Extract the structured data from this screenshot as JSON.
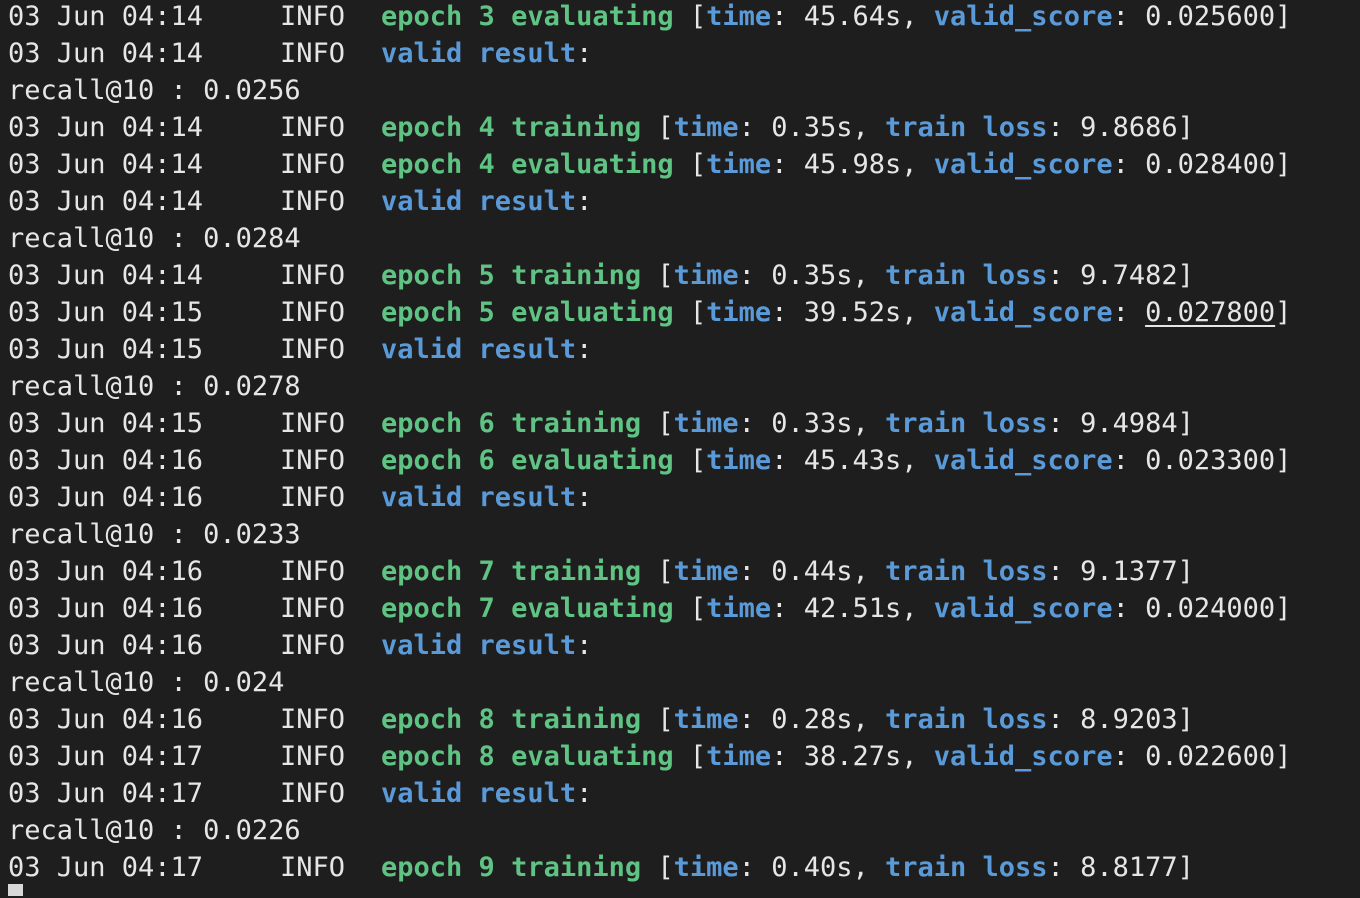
{
  "lines": [
    {
      "kind": "eval",
      "ts": "03 Jun 04:14",
      "level": "INFO",
      "epoch": "3",
      "time": "45.64s",
      "score": "0.025600"
    },
    {
      "kind": "result",
      "ts": "03 Jun 04:14",
      "level": "INFO"
    },
    {
      "kind": "recall",
      "text": "recall@10 : 0.0256"
    },
    {
      "kind": "train",
      "ts": "03 Jun 04:14",
      "level": "INFO",
      "epoch": "4",
      "time": "0.35s",
      "loss": "9.8686"
    },
    {
      "kind": "eval",
      "ts": "03 Jun 04:14",
      "level": "INFO",
      "epoch": "4",
      "time": "45.98s",
      "score": "0.028400"
    },
    {
      "kind": "result",
      "ts": "03 Jun 04:14",
      "level": "INFO"
    },
    {
      "kind": "recall",
      "text": "recall@10 : 0.0284"
    },
    {
      "kind": "train",
      "ts": "03 Jun 04:14",
      "level": "INFO",
      "epoch": "5",
      "time": "0.35s",
      "loss": "9.7482"
    },
    {
      "kind": "eval",
      "ts": "03 Jun 04:15",
      "level": "INFO",
      "epoch": "5",
      "time": "39.52s",
      "score": "0.027800",
      "underline": true
    },
    {
      "kind": "result",
      "ts": "03 Jun 04:15",
      "level": "INFO"
    },
    {
      "kind": "recall",
      "text": "recall@10 : 0.0278"
    },
    {
      "kind": "train",
      "ts": "03 Jun 04:15",
      "level": "INFO",
      "epoch": "6",
      "time": "0.33s",
      "loss": "9.4984"
    },
    {
      "kind": "eval",
      "ts": "03 Jun 04:16",
      "level": "INFO",
      "epoch": "6",
      "time": "45.43s",
      "score": "0.023300"
    },
    {
      "kind": "result",
      "ts": "03 Jun 04:16",
      "level": "INFO"
    },
    {
      "kind": "recall",
      "text": "recall@10 : 0.0233"
    },
    {
      "kind": "train",
      "ts": "03 Jun 04:16",
      "level": "INFO",
      "epoch": "7",
      "time": "0.44s",
      "loss": "9.1377"
    },
    {
      "kind": "eval",
      "ts": "03 Jun 04:16",
      "level": "INFO",
      "epoch": "7",
      "time": "42.51s",
      "score": "0.024000"
    },
    {
      "kind": "result",
      "ts": "03 Jun 04:16",
      "level": "INFO"
    },
    {
      "kind": "recall",
      "text": "recall@10 : 0.024"
    },
    {
      "kind": "train",
      "ts": "03 Jun 04:16",
      "level": "INFO",
      "epoch": "8",
      "time": "0.28s",
      "loss": "8.9203"
    },
    {
      "kind": "eval",
      "ts": "03 Jun 04:17",
      "level": "INFO",
      "epoch": "8",
      "time": "38.27s",
      "score": "0.022600"
    },
    {
      "kind": "result",
      "ts": "03 Jun 04:17",
      "level": "INFO"
    },
    {
      "kind": "recall",
      "text": "recall@10 : 0.0226"
    },
    {
      "kind": "train",
      "ts": "03 Jun 04:17",
      "level": "INFO",
      "epoch": "9",
      "time": "0.40s",
      "loss": "8.8177"
    }
  ],
  "colors": {
    "background": "#1e1e1e",
    "text": "#e6e6e6",
    "green": "#5fc383",
    "blue": "#5b9ad8"
  }
}
